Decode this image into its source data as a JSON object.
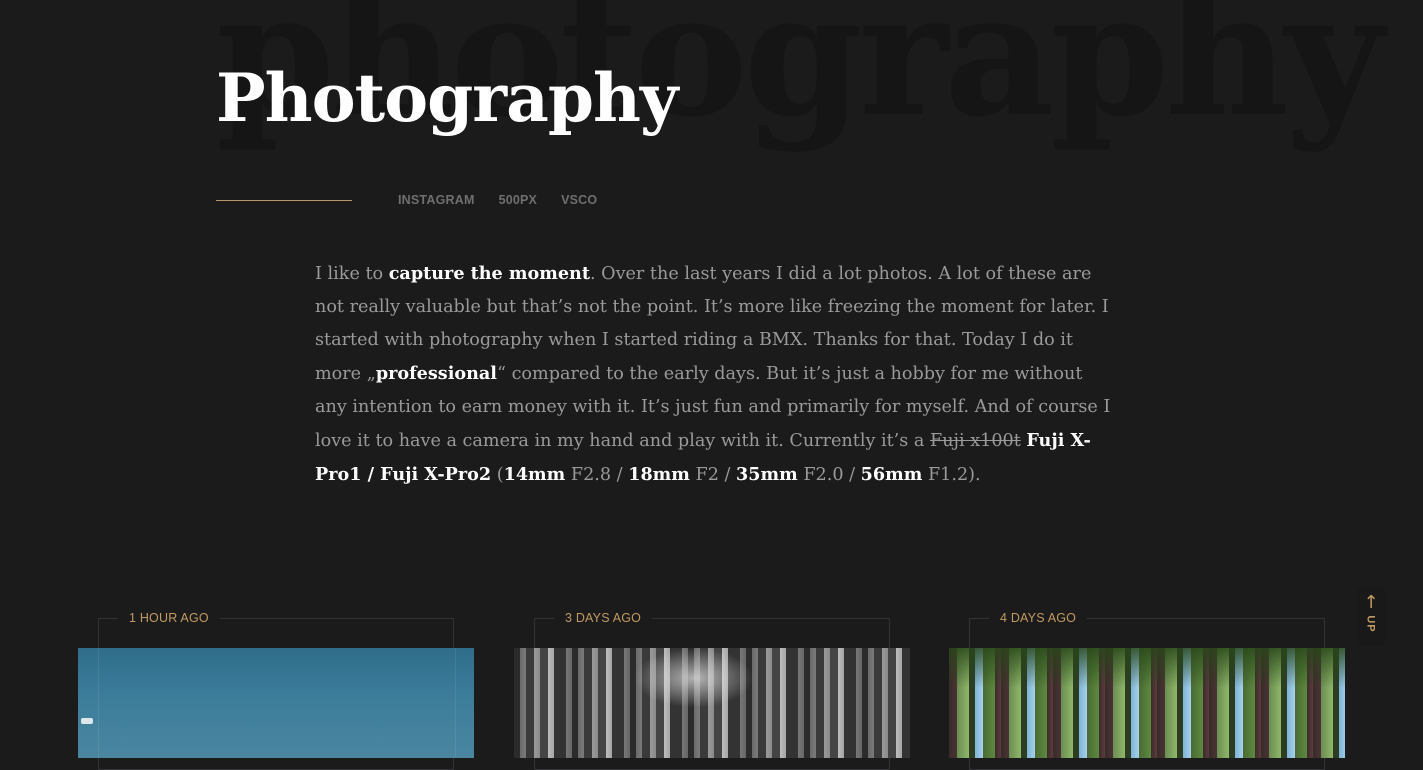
{
  "header": {
    "background_word": "photography",
    "title": "Photography"
  },
  "social": [
    {
      "label": "INSTAGRAM"
    },
    {
      "label": "500PX"
    },
    {
      "label": "VSCO"
    }
  ],
  "intro": {
    "p1": "I like to ",
    "b1": "capture the moment",
    "p2": ". Over the last years I did a lot photos. A lot of these are not really valuable but that’s not the point. It’s more like freezing the moment for later. I started with photography when I started riding a BMX. Thanks for that. Today I do it more „",
    "b2": "professional",
    "p3": "“ compared to the early days. But it’s just a hobby for me without any intention to earn money with it. It’s just fun and primarily for myself. And of course I love it to have a camera in my hand and play with it. Currently it’s a ",
    "strike": "Fuji x100t",
    "p4": " ",
    "b3": "Fuji X-Pro1 / Fuji X-Pro2",
    "p5": " (",
    "b4": "14mm",
    "p6": " F2.8 / ",
    "b5": "18mm",
    "p7": " F2 / ",
    "b6": "35mm",
    "p8": " F2.0 / ",
    "b7": "56mm",
    "p9": " F1.2)."
  },
  "cards": [
    {
      "time": "1 HOUR AGO"
    },
    {
      "time": "3 DAYS AGO"
    },
    {
      "time": "4 DAYS AGO"
    }
  ],
  "up_button": {
    "label": "UP",
    "icon": "arrow-up-icon"
  },
  "colors": {
    "background": "#1b1b1c",
    "accent": "#c29a62",
    "text": "#9a9a9a",
    "strong": "#ffffff"
  }
}
